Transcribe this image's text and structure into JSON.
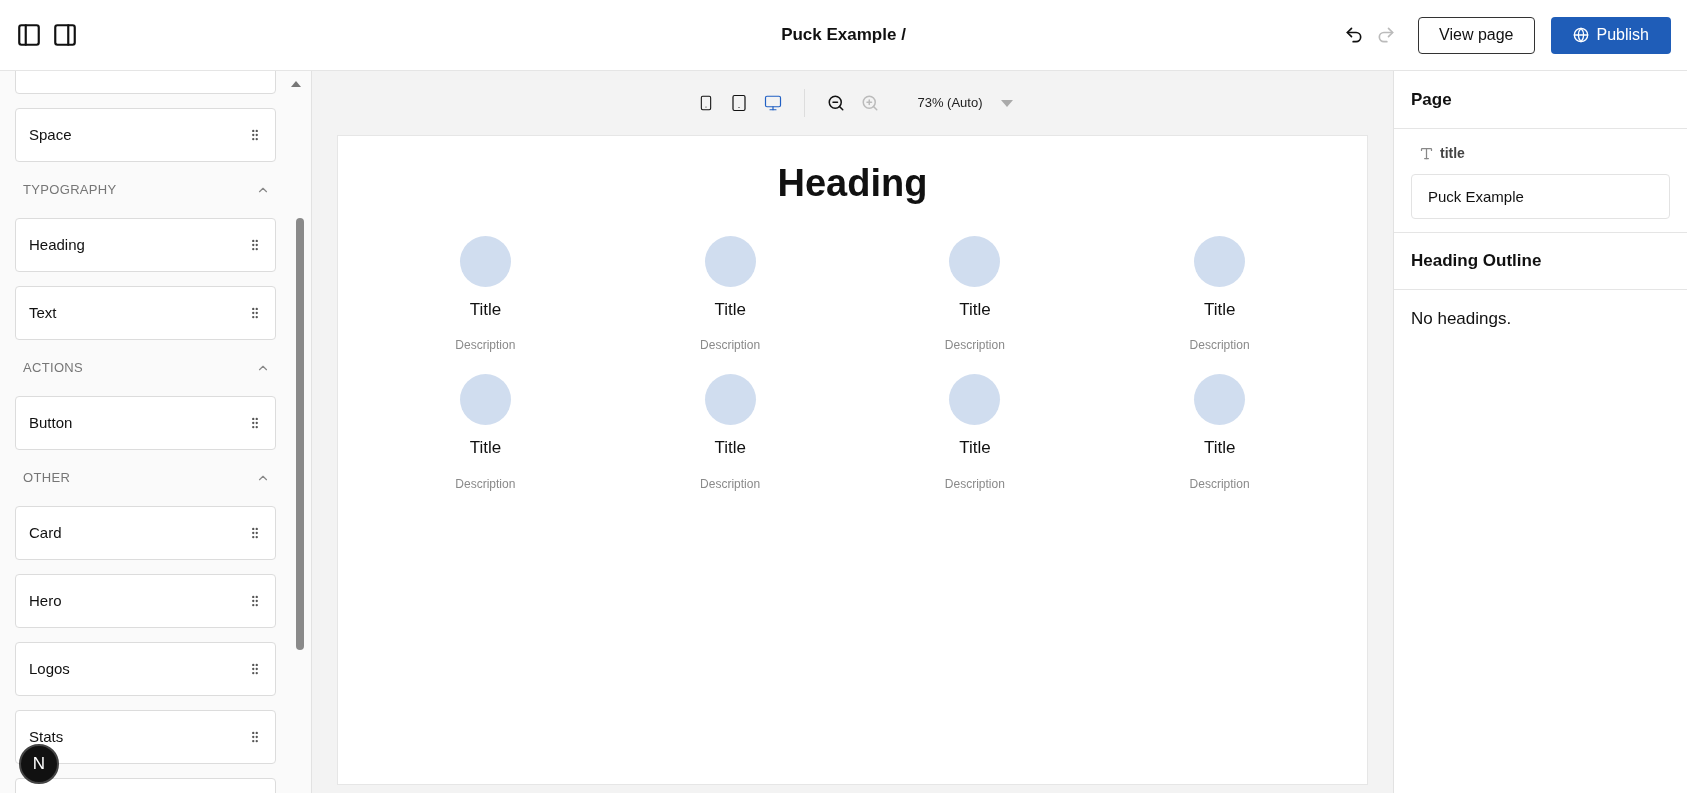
{
  "header": {
    "title": "Puck Example /",
    "left_panel_toggle": {
      "selected": true
    },
    "right_panel_toggle": {
      "selected": true
    },
    "undo": {
      "disabled": false
    },
    "redo": {
      "disabled": true
    },
    "buttons": [
      {
        "kind": "outline",
        "label": "View page"
      },
      {
        "kind": "primary",
        "label": "Publish"
      }
    ]
  },
  "sidebar": {
    "entries": [
      {
        "kind": "clipped"
      },
      {
        "kind": "item",
        "label": "Space"
      },
      {
        "kind": "category",
        "label": "TYPOGRAPHY",
        "expanded": true
      },
      {
        "kind": "item",
        "label": "Heading"
      },
      {
        "kind": "item",
        "label": "Text"
      },
      {
        "kind": "category",
        "label": "ACTIONS",
        "expanded": true
      },
      {
        "kind": "item",
        "label": "Button"
      },
      {
        "kind": "category",
        "label": "OTHER",
        "expanded": true
      },
      {
        "kind": "item",
        "label": "Card"
      },
      {
        "kind": "item",
        "label": "Hero"
      },
      {
        "kind": "item",
        "label": "Logos"
      },
      {
        "kind": "item",
        "label": "Stats"
      },
      {
        "kind": "clipped"
      }
    ],
    "badge": "N"
  },
  "canvas": {
    "viewports": [
      {
        "kind": "mobile",
        "selected": false
      },
      {
        "kind": "tablet",
        "selected": false
      },
      {
        "kind": "desktop",
        "selected": true
      }
    ],
    "zoom_out": {
      "disabled": false
    },
    "zoom_in": {
      "disabled": true
    },
    "zoom": "73% (Auto)",
    "page": {
      "heading": "Heading",
      "cards": [
        {
          "title": "Title",
          "description": "Description"
        },
        {
          "title": "Title",
          "description": "Description"
        },
        {
          "title": "Title",
          "description": "Description"
        },
        {
          "title": "Title",
          "description": "Description"
        },
        {
          "title": "Title",
          "description": "Description"
        },
        {
          "title": "Title",
          "description": "Description"
        },
        {
          "title": "Title",
          "description": "Description"
        },
        {
          "title": "Title",
          "description": "Description"
        }
      ]
    }
  },
  "right_panel": {
    "title": "Page",
    "fields": [
      {
        "label": "title",
        "value": "Puck Example"
      }
    ],
    "outline_title": "Heading Outline",
    "outline_empty": "No headings."
  }
}
